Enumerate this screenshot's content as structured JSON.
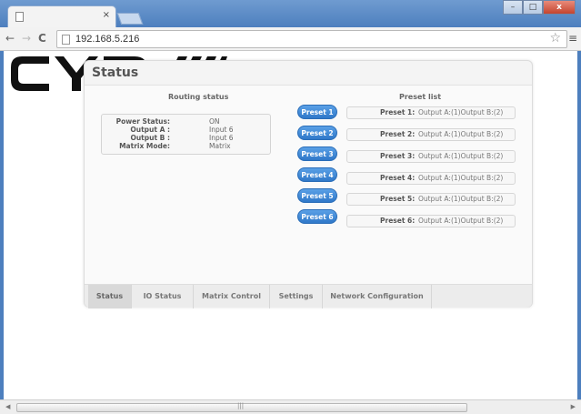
{
  "browser": {
    "tab_close": "×",
    "url": "192.168.5.216",
    "window_buttons": {
      "minimize": "–",
      "maximize": "□",
      "close": "x"
    }
  },
  "panel": {
    "title": "Status"
  },
  "routing": {
    "heading": "Routing status",
    "rows": [
      {
        "label": "Power Status:",
        "value": "ON"
      },
      {
        "label": "Output A :",
        "value": "Input 6"
      },
      {
        "label": "Output B :",
        "value": "Input 6"
      },
      {
        "label": "Matrix Mode:",
        "value": "Matrix"
      }
    ]
  },
  "presets": {
    "heading": "Preset list",
    "items": [
      {
        "button": "Preset 1",
        "label": "Preset 1:",
        "value": "Output A:(1)Output B:(2)"
      },
      {
        "button": "Preset 2",
        "label": "Preset 2:",
        "value": "Output A:(1)Output B:(2)"
      },
      {
        "button": "Preset 3",
        "label": "Preset 3:",
        "value": "Output A:(1)Output B:(2)"
      },
      {
        "button": "Preset 4",
        "label": "Preset 4:",
        "value": "Output A:(1)Output B:(2)"
      },
      {
        "button": "Preset 5",
        "label": "Preset 5:",
        "value": "Output A:(1)Output B:(2)"
      },
      {
        "button": "Preset 6",
        "label": "Preset 6:",
        "value": "Output A:(1)Output B:(2)"
      }
    ]
  },
  "tabs": [
    {
      "label": "Status",
      "active": true
    },
    {
      "label": "IO Status",
      "active": false
    },
    {
      "label": "Matrix Control",
      "active": false
    },
    {
      "label": "Settings",
      "active": false
    },
    {
      "label": "Network Configuration",
      "active": false
    }
  ],
  "colors": {
    "accent": "#2f78c9",
    "frame": "#4d7fbe"
  },
  "icons": [
    "page-icon",
    "back-arrow-icon",
    "forward-arrow-icon",
    "reload-icon",
    "star-icon",
    "menu-icon"
  ]
}
